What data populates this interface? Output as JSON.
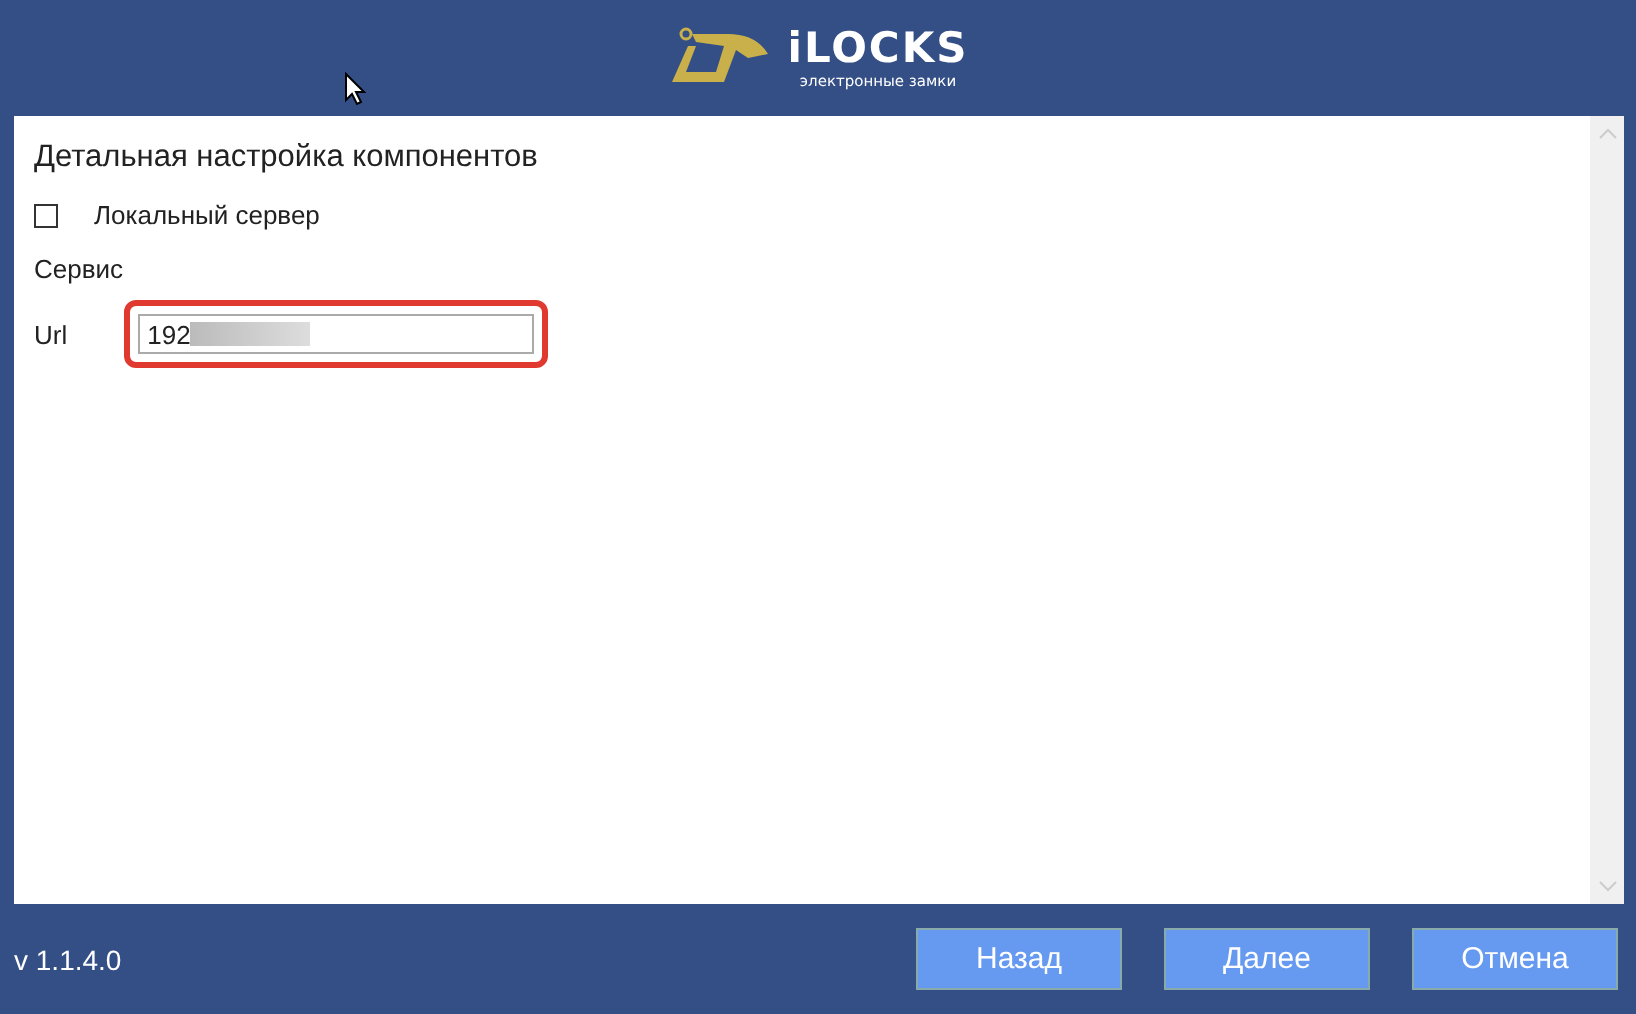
{
  "header": {
    "logo_title": "iLOCKS",
    "logo_subtitle": "электронные замки"
  },
  "panel": {
    "title": "Детальная настройка компонентов",
    "checkbox": {
      "label": "Локальный сервер",
      "checked": false
    },
    "section": "Сервис",
    "url": {
      "label": "Url",
      "value": "192",
      "highlighted": true
    }
  },
  "footer": {
    "version": "v 1.1.4.0",
    "buttons": [
      "Назад",
      "Далее",
      "Отмена"
    ]
  }
}
